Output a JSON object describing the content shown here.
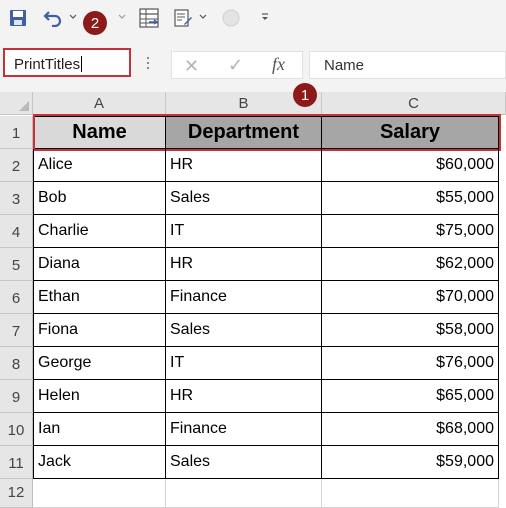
{
  "quick_access": {
    "icons": [
      "save-icon",
      "undo-icon",
      "dropdown-icon",
      "table-icon",
      "form-icon",
      "circle-icon",
      "customize-icon"
    ]
  },
  "badges": {
    "one": "1",
    "two": "2"
  },
  "formula_bar": {
    "name_box": "PrintTitles",
    "cancel_symbol": "✕",
    "enter_symbol": "✓",
    "fx_symbol": "fx",
    "formula": "Name"
  },
  "colors": {
    "highlight": "#c8303a",
    "badge": "#8c1a1a",
    "header_a": "#d9d9d9",
    "header_bc": "#a6a6a6"
  },
  "sheet": {
    "columns": [
      "A",
      "B",
      "C"
    ],
    "row_numbers": [
      "1",
      "2",
      "3",
      "4",
      "5",
      "6",
      "7",
      "8",
      "9",
      "10",
      "11",
      "12"
    ],
    "headers": [
      "Name",
      "Department",
      "Salary"
    ],
    "rows": [
      [
        "Alice",
        "HR",
        "$60,000"
      ],
      [
        "Bob",
        "Sales",
        "$55,000"
      ],
      [
        "Charlie",
        "IT",
        "$75,000"
      ],
      [
        "Diana",
        "HR",
        "$62,000"
      ],
      [
        "Ethan",
        "Finance",
        "$70,000"
      ],
      [
        "Fiona",
        "Sales",
        "$58,000"
      ],
      [
        "George",
        "IT",
        "$76,000"
      ],
      [
        "Helen",
        "HR",
        "$65,000"
      ],
      [
        "Ian",
        "Finance",
        "$68,000"
      ],
      [
        "Jack",
        "Sales",
        "$59,000"
      ]
    ]
  }
}
